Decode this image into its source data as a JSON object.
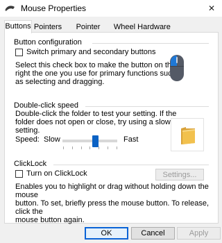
{
  "window": {
    "title": "Mouse Properties",
    "close_glyph": "✕"
  },
  "tabs": [
    {
      "label": "Buttons",
      "active": true
    },
    {
      "label": "Pointers"
    },
    {
      "label": "Pointer Options"
    },
    {
      "label": "Wheel"
    },
    {
      "label": "Hardware"
    }
  ],
  "button_config": {
    "title": "Button configuration",
    "checkbox_label": "Switch primary and secondary buttons",
    "checked": false,
    "description": [
      "Select this check box to make the button on the",
      "right the one you use for primary functions such",
      "as selecting and dragging."
    ],
    "icon": "mouse-icon"
  },
  "double_click": {
    "title": "Double-click speed",
    "description": [
      "Double-click the folder to test your setting. If the",
      "folder does not open or close, try using a slower",
      "setting."
    ],
    "speed_label": "Speed:",
    "slow_label": "Slow",
    "fast_label": "Fast",
    "slider_value_fraction": 0.6,
    "icon": "folder-icon"
  },
  "clicklock": {
    "title": "ClickLock",
    "checkbox_label": "Turn on ClickLock",
    "checked": false,
    "settings_label": "Settings...",
    "description": [
      "Enables you to highlight or drag without holding down the mouse",
      "button. To set, briefly press the mouse button. To release, click the",
      "mouse button again."
    ]
  },
  "footer": {
    "ok": "OK",
    "cancel": "Cancel",
    "apply": "Apply"
  },
  "colors": {
    "accent": "#0b62c4",
    "folder": "#f2c14e"
  }
}
